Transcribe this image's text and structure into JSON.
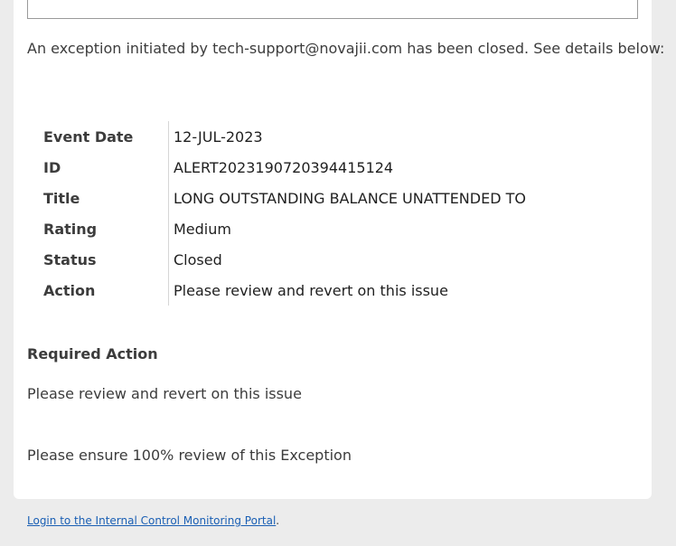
{
  "email": {
    "intro": "An exception initiated by tech-support@novajii.com has been closed. See details below:",
    "details": [
      {
        "label": "Event Date",
        "value": "12-JUL-2023"
      },
      {
        "label": "ID",
        "value": "ALERT2023190720394415124"
      },
      {
        "label": "Title",
        "value": "LONG OUTSTANDING BALANCE UNATTENDED TO"
      },
      {
        "label": "Rating",
        "value": "Medium"
      },
      {
        "label": "Status",
        "value": "Closed"
      },
      {
        "label": "Action",
        "value": "Please review and revert on this issue"
      }
    ],
    "required_action_title": "Required Action",
    "required_action_text": "Please review and revert on this issue",
    "ensure_text": "Please ensure 100% review of this Exception"
  },
  "footer": {
    "link_text": "Login to the Internal Control Monitoring Portal",
    "suffix": "."
  }
}
